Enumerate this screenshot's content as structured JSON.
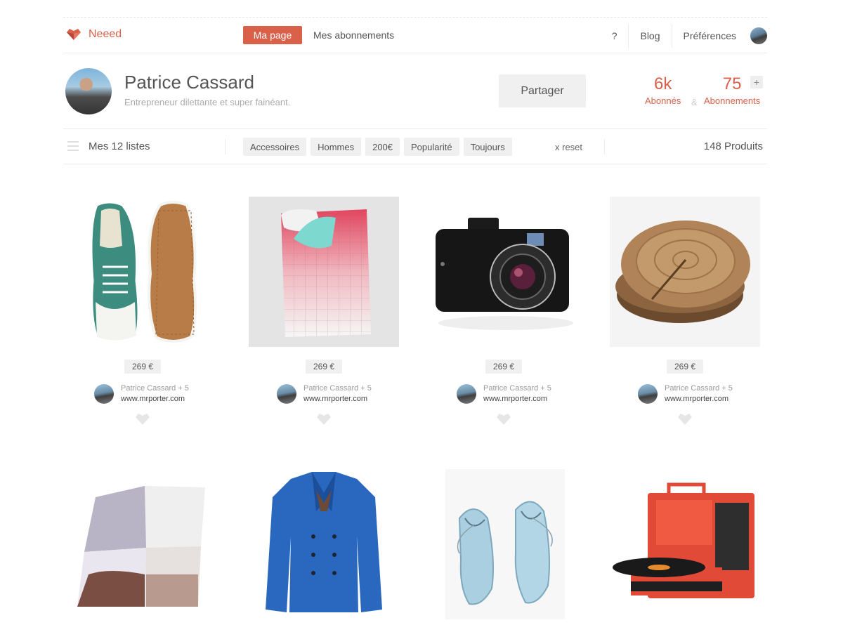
{
  "header": {
    "logo_text": "Neeed",
    "tab_mypage": "Ma page",
    "tab_subscriptions": "Mes abonnements",
    "help": "?",
    "blog": "Blog",
    "preferences": "Préférences"
  },
  "profile": {
    "name": "Patrice Cassard",
    "bio": "Entrepreneur dilettante et super fainéant.",
    "share_label": "Partager",
    "followers_count": "6k",
    "followers_label": "Abonnés",
    "amp": "&",
    "following_count": "75",
    "following_label": "Abonnements",
    "plus": "+"
  },
  "filterbar": {
    "lists_label": "Mes 12 listes",
    "filters": [
      "Accessoires",
      "Hommes",
      "200€",
      "Popularité",
      "Toujours"
    ],
    "reset_label": "x  reset",
    "product_count": "148 Produits"
  },
  "products": [
    {
      "image": "green-sneakers",
      "price": "269 €",
      "owner": "Patrice Cassard + 5",
      "site": "www.mrporter.com"
    },
    {
      "image": "pink-bedding",
      "price": "269 €",
      "owner": "Patrice Cassard + 5",
      "site": "www.mrporter.com"
    },
    {
      "image": "black-camera",
      "price": "269 €",
      "owner": "Patrice Cassard + 5",
      "site": "www.mrporter.com"
    },
    {
      "image": "wood-coasters",
      "price": "269 €",
      "owner": "Patrice Cassard + 5",
      "site": "www.mrporter.com"
    },
    {
      "image": "silk-scarf"
    },
    {
      "image": "blue-peacoat"
    },
    {
      "image": "light-blue-shoes"
    },
    {
      "image": "red-record-player"
    }
  ],
  "colors": {
    "accent": "#d9614a"
  }
}
